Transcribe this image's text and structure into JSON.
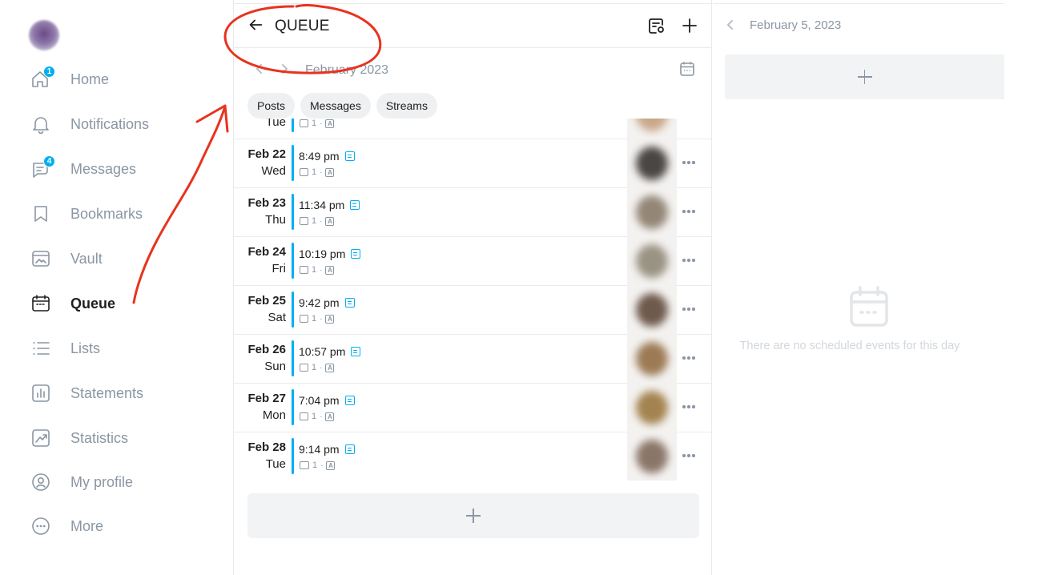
{
  "sidebar": {
    "items": [
      {
        "label": "Home",
        "icon": "home-icon",
        "badge": "1"
      },
      {
        "label": "Notifications",
        "icon": "bell-icon"
      },
      {
        "label": "Messages",
        "icon": "chat-icon",
        "badge": "4"
      },
      {
        "label": "Bookmarks",
        "icon": "bookmark-icon"
      },
      {
        "label": "Vault",
        "icon": "vault-icon"
      },
      {
        "label": "Queue",
        "icon": "calendar-icon",
        "active": true
      },
      {
        "label": "Lists",
        "icon": "list-icon"
      },
      {
        "label": "Statements",
        "icon": "statements-icon"
      },
      {
        "label": "Statistics",
        "icon": "statistics-icon"
      },
      {
        "label": "My profile",
        "icon": "profile-icon"
      },
      {
        "label": "More",
        "icon": "more-icon"
      }
    ]
  },
  "header": {
    "title": "QUEUE"
  },
  "month": {
    "label": "February 2023"
  },
  "chips": [
    "Posts",
    "Messages",
    "Streams"
  ],
  "partial_row": {
    "dow": "Tue",
    "count": "1"
  },
  "queue": [
    {
      "date": "Feb 22",
      "dow": "Wed",
      "time": "8:49 pm",
      "media": "image",
      "count": "1",
      "thumb": "#4a4644"
    },
    {
      "date": "Feb 23",
      "dow": "Thu",
      "time": "11:34 pm",
      "media": "image",
      "count": "1",
      "thumb": "#938677"
    },
    {
      "date": "Feb 24",
      "dow": "Fri",
      "time": "10:19 pm",
      "media": "image",
      "count": "1",
      "thumb": "#9a9384"
    },
    {
      "date": "Feb 25",
      "dow": "Sat",
      "time": "9:42 pm",
      "media": "image",
      "count": "1",
      "thumb": "#6e5a4d"
    },
    {
      "date": "Feb 26",
      "dow": "Sun",
      "time": "10:57 pm",
      "media": "image",
      "count": "1",
      "thumb": "#9c7a55"
    },
    {
      "date": "Feb 27",
      "dow": "Mon",
      "time": "7:04 pm",
      "media": "image",
      "count": "1",
      "thumb": "#a3834f"
    },
    {
      "date": "Feb 28",
      "dow": "Tue",
      "time": "9:14 pm",
      "media": "video",
      "count": "1",
      "thumb": "#8a7669"
    }
  ],
  "day_panel": {
    "date": "February 5, 2023",
    "empty_text": "There are no scheduled events for this day"
  },
  "colors": {
    "accent": "#00aff0",
    "annotation": "#e8331e"
  }
}
